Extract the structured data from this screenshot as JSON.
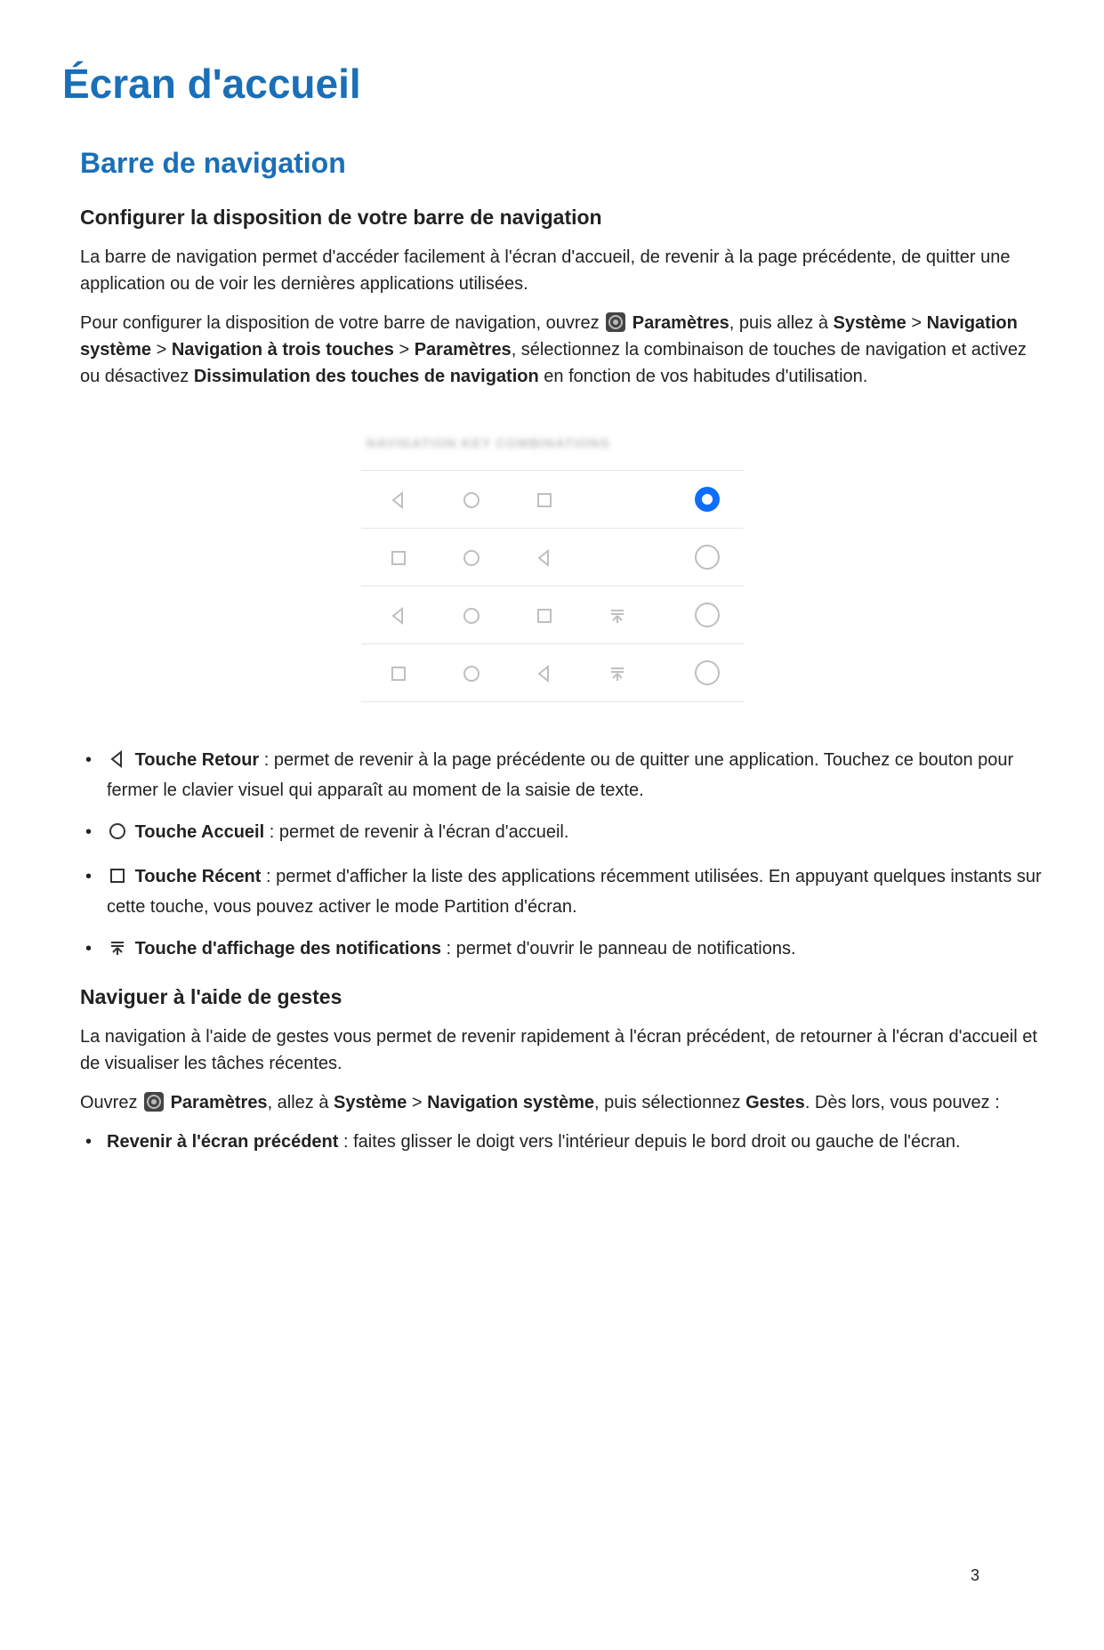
{
  "page_number": "3",
  "title": "Écran d'accueil",
  "section_title": "Barre de navigation",
  "configure": {
    "heading": "Configurer la disposition de votre barre de navigation",
    "intro": "La barre de navigation permet d'accéder facilement à l'écran d'accueil, de revenir à la page précédente, de quitter une application ou de voir les dernières applications utilisées.",
    "p2_pre": "Pour configurer la disposition de votre barre de navigation, ouvrez ",
    "p2_param": "Paramètres",
    "p2_mid1": ", puis allez à ",
    "p2_sys": "Système",
    "p2_sep": " > ",
    "p2_navsys": "Navigation système",
    "p2_nav3": "Navigation à trois touches",
    "p2_param2": "Paramètres",
    "p2_after": ", sélectionnez la combinaison de touches de navigation et activez ou désactivez ",
    "p2_diss": "Dissimulation des touches de navigation",
    "p2_end": " en fonction de vos habitudes d'utilisation."
  },
  "figure": {
    "blurred_label": "NAVIGATION KEY COMBINATIONS"
  },
  "buttons": {
    "back_label": "Touche Retour",
    "back_desc": " : permet de revenir à la page précédente ou de quitter une application. Touchez ce bouton pour fermer le clavier visuel qui apparaît au moment de la saisie de texte.",
    "home_label": "Touche Accueil",
    "home_desc": " : permet de revenir à l'écran d'accueil.",
    "recent_label": "Touche Récent",
    "recent_desc": " : permet d'afficher la liste des applications récemment utilisées. En appuyant quelques instants sur cette touche, vous pouvez activer le mode Partition d'écran.",
    "notif_label": "Touche d'affichage des notifications",
    "notif_desc": " : permet d'ouvrir le panneau de notifications."
  },
  "gestures": {
    "heading": "Naviguer à l'aide de gestes",
    "intro": "La navigation à l'aide de gestes vous permet de revenir rapidement à l'écran précédent, de retourner à l'écran d'accueil et de visualiser les tâches récentes.",
    "p2_pre": "Ouvrez ",
    "p2_param": "Paramètres",
    "p2_mid": ", allez à ",
    "p2_sys": "Système",
    "p2_sep": " > ",
    "p2_navsys": "Navigation système",
    "p2_after": ", puis sélectionnez ",
    "p2_gestes": "Gestes",
    "p2_end": ". Dès lors, vous pouvez :",
    "bullet1_label": "Revenir à l'écran précédent",
    "bullet1_desc": " : faites glisser le doigt vers l'intérieur depuis le bord droit ou gauche de l'écran."
  }
}
